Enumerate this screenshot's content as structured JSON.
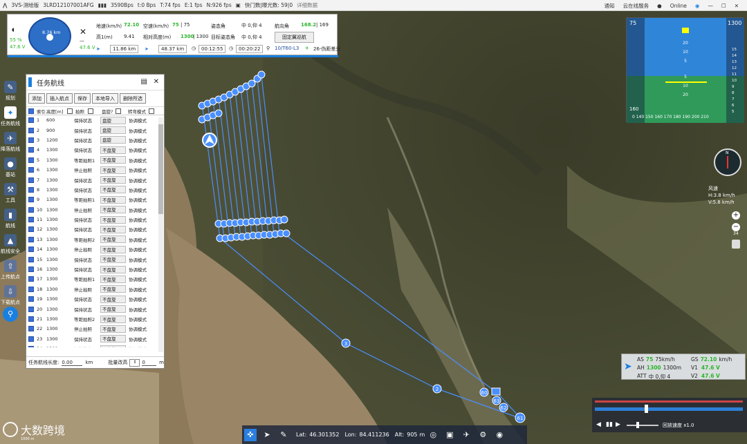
{
  "titlebar": {
    "app": "3VS-测绘版",
    "serial": "3LRD12107001AFG",
    "bandwidth": "3590Bps",
    "fps1": "t:0 Bps",
    "fps2": "T:74 fps",
    "fps3": "E:1 fps",
    "fps4": "N:926 fps",
    "storage": "快门数|曝光数: 59|0",
    "extra": "详细数据",
    "notify": "通知",
    "cloud": "云noHTTP在线服务",
    "online": "Online"
  },
  "hud": {
    "heading_dist": "8.76 km",
    "battery_pct": "55 %",
    "battery_v": "47.6 V",
    "voltage2": "47.6 V",
    "dash": "—",
    "gs_label": "地速(km/h)",
    "gs": "72.10",
    "as_label": "空速(km/h)",
    "as": "75",
    "as_sep": "| 75",
    "att_label": "姿态角",
    "att": "中 0,仰 4",
    "heading_label": "航向角",
    "heading": "168.2",
    "heading_sep": "| 169",
    "alt_label": "高1(m)",
    "alt": "9.41",
    "rel_label": "相对高度(m)",
    "rel": "1300",
    "rel_sep": "| 1300",
    "tgt_label": "目标姿态角",
    "tgt": "中 0,仰 4",
    "mode_btn": "固定翼巡航",
    "dist1": "11.86 km",
    "dist2": "48.37 km",
    "time1": "00:12:55",
    "time2": "00:20:22",
    "wp": "10/T60-L3",
    "gps": "26-伪距差分"
  },
  "nav": [
    {
      "label": "规划"
    },
    {
      "label": "任务航线"
    },
    {
      "label": "降落航线"
    },
    {
      "label": "基站"
    },
    {
      "label": "工具"
    },
    {
      "label": "航线"
    },
    {
      "label": "航线安全"
    },
    {
      "label": "上传航点"
    },
    {
      "label": "下载航点"
    }
  ],
  "panel": {
    "title": "任务航线",
    "buttons": [
      "添加",
      "插入航点",
      "保存",
      "本地导入",
      "删除所选"
    ],
    "cols": [
      "索引",
      "高度[m]",
      "拍照",
      "盘旋?",
      "转弯模式"
    ],
    "rows": [
      {
        "i": "1",
        "h": "600",
        "a": "保持状态",
        "c": "盘旋",
        "t": "协调模式"
      },
      {
        "i": "2",
        "h": "900",
        "a": "保持状态",
        "c": "盘旋",
        "t": "协调模式"
      },
      {
        "i": "3",
        "h": "1200",
        "a": "保持状态",
        "c": "盘旋",
        "t": "协调模式"
      },
      {
        "i": "4",
        "h": "1300",
        "a": "保持状态",
        "c": "不盘旋",
        "t": "协调模式"
      },
      {
        "i": "5",
        "h": "1300",
        "a": "等距拍照1",
        "c": "不盘旋",
        "t": "协调模式"
      },
      {
        "i": "6",
        "h": "1300",
        "a": "停止拍照",
        "c": "不盘旋",
        "t": "协调模式"
      },
      {
        "i": "7",
        "h": "1300",
        "a": "保持状态",
        "c": "不盘旋",
        "t": "协调模式"
      },
      {
        "i": "8",
        "h": "1300",
        "a": "保持状态",
        "c": "不盘旋",
        "t": "协调模式"
      },
      {
        "i": "9",
        "h": "1300",
        "a": "等距拍照1",
        "c": "不盘旋",
        "t": "协调模式"
      },
      {
        "i": "10",
        "h": "1300",
        "a": "停止拍照",
        "c": "不盘旋",
        "t": "协调模式"
      },
      {
        "i": "11",
        "h": "1300",
        "a": "保持状态",
        "c": "不盘旋",
        "t": "协调模式"
      },
      {
        "i": "12",
        "h": "1300",
        "a": "保持状态",
        "c": "不盘旋",
        "t": "协调模式"
      },
      {
        "i": "13",
        "h": "1300",
        "a": "等距拍照2",
        "c": "不盘旋",
        "t": "协调模式"
      },
      {
        "i": "14",
        "h": "1300",
        "a": "停止拍照",
        "c": "不盘旋",
        "t": "协调模式"
      },
      {
        "i": "15",
        "h": "1300",
        "a": "保持状态",
        "c": "不盘旋",
        "t": "协调模式"
      },
      {
        "i": "16",
        "h": "1300",
        "a": "保持状态",
        "c": "不盘旋",
        "t": "协调模式"
      },
      {
        "i": "17",
        "h": "1300",
        "a": "等距拍照1",
        "c": "不盘旋",
        "t": "协调模式"
      },
      {
        "i": "18",
        "h": "1300",
        "a": "停止拍照",
        "c": "不盘旋",
        "t": "协调模式"
      },
      {
        "i": "19",
        "h": "1300",
        "a": "保持状态",
        "c": "不盘旋",
        "t": "协调模式"
      },
      {
        "i": "20",
        "h": "1300",
        "a": "保持状态",
        "c": "不盘旋",
        "t": "协调模式"
      },
      {
        "i": "21",
        "h": "1300",
        "a": "等距拍照2",
        "c": "不盘旋",
        "t": "协调模式"
      },
      {
        "i": "22",
        "h": "1300",
        "a": "停止拍照",
        "c": "不盘旋",
        "t": "协调模式"
      },
      {
        "i": "23",
        "h": "1300",
        "a": "保持状态",
        "c": "不盘旋",
        "t": "协调模式"
      },
      {
        "i": "24",
        "h": "1300",
        "a": "保持状态",
        "c": "不盘旋",
        "t": "协调模式"
      }
    ],
    "foot_len_label": "任务航线长度:",
    "foot_len": "0.00",
    "foot_len_unit": "km",
    "foot_batch": "批量改高",
    "foot_val": "0",
    "foot_unit": "m"
  },
  "pfd": {
    "spd": "75",
    "alt": "1300",
    "spd_bottom": "160",
    "scale": "0 140 150 160 170 180 190 200 210",
    "pitch": [
      "20",
      "10",
      "5",
      "5",
      "10",
      "20"
    ],
    "vsi": [
      "15",
      "14",
      "13",
      "12",
      "11",
      "10",
      "9",
      "8",
      "7",
      "6",
      "5"
    ],
    "spd_tape": [
      "150",
      "140",
      "130",
      "120",
      "110",
      "100",
      "90",
      "80",
      "70",
      "60",
      "50",
      "40",
      "30"
    ]
  },
  "compass": {
    "n": "N"
  },
  "wind": {
    "label": "风速",
    "h": "H:3.8 km/h",
    "v": "V:5.8 km/h"
  },
  "zoom": {
    "level": "34"
  },
  "airdata": {
    "as_l": "AS",
    "as": "75",
    "as_sep": "75km/h",
    "gs_l": "GS",
    "gs": "72.10",
    "gs_u": "km/h",
    "ah_l": "AH",
    "ah": "1300",
    "ah_sep": "1300m",
    "v1_l": "V1",
    "v1": "47.6 V",
    "att_l": "ATT",
    "att": "中 0,仰 4",
    "v2_l": "V2",
    "v2": "47.6 V"
  },
  "playback": {
    "speed": "回放速度 x1.0"
  },
  "bottombar": {
    "lat_l": "Lat:",
    "lat": "46.301352",
    "lon_l": "Lon:",
    "lon": "84.411236",
    "alt_l": "Alt:",
    "alt": "905",
    "alt_u": "m"
  },
  "watermark": {
    "text": "大数跨境",
    "scale": "1000 m"
  },
  "waypoints": {
    "labels": [
      "3",
      "2",
      "60",
      "63",
      "62",
      "61"
    ]
  },
  "colors": {
    "route": "#4a8fff",
    "accent": "#1a7fe0",
    "gs_green": "#2bb52b"
  }
}
